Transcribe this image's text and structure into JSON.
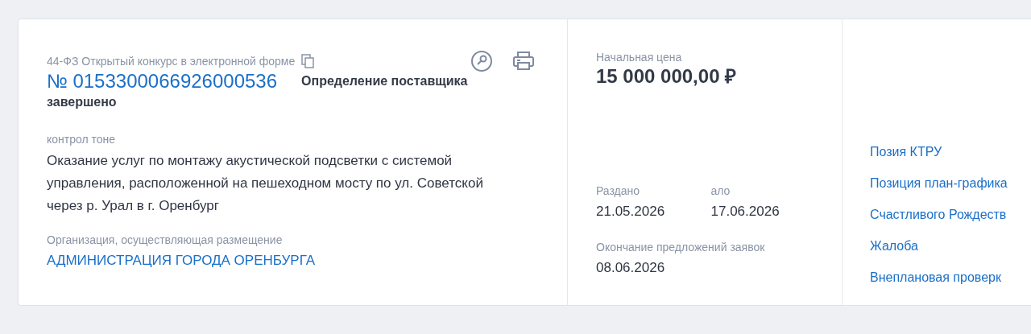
{
  "header": {
    "law": "44-ФЗ",
    "procedure": "Открытый конкурс в электронной форме",
    "number": "№ 0153300066926000536",
    "status_lines": [
      "Определение поставщика",
      "завершено"
    ]
  },
  "subject": {
    "label": "контрол тоне",
    "text": "Оказание услуг по монтажу акустической подсветки с системой управления, расположенной на пешеходном мосту по ул. Советской через р. Урал в г. Оренбург"
  },
  "organization": {
    "label": "Организация, осуществляющая размещение",
    "name": "АДМИНИСТРАЦИЯ ГОРОДА ОРЕНБУРГА"
  },
  "price": {
    "label": "Начальная цена",
    "value": "15 000 000,00 ₽"
  },
  "dates": [
    {
      "label": "Раздано",
      "value": "21.05.2026"
    },
    {
      "label": "ало",
      "value": "17.06.2026"
    }
  ],
  "deadline": {
    "label": "Окончание предложений заявок",
    "value": "08.06.2026"
  },
  "links": [
    "Позия КТРУ",
    "Позиция план-графика",
    "Счастливого Рождеств",
    "Жалоба",
    "Внеплановая проверк"
  ]
}
